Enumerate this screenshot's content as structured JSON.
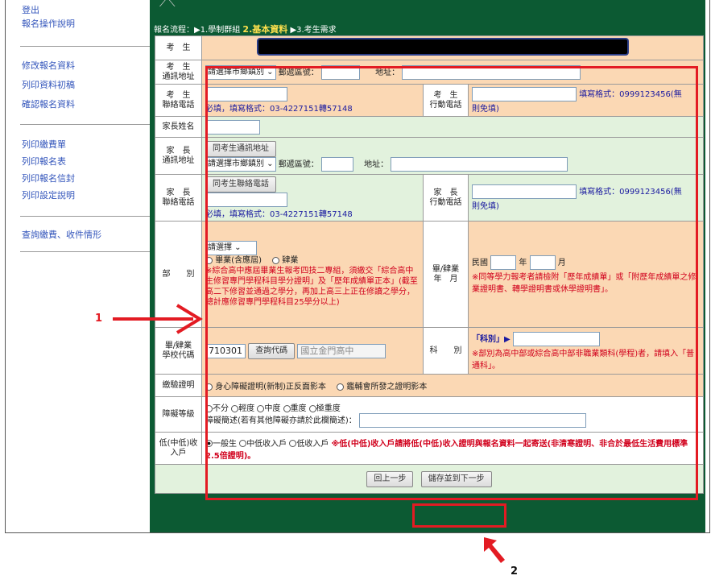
{
  "sidebar": {
    "items": [
      {
        "label": "登出"
      },
      {
        "label": "報名操作說明"
      },
      {
        "label": "修改報名資料"
      },
      {
        "label": "列印資料初稿"
      },
      {
        "label": "確認報名資料"
      },
      {
        "label": "列印繳費單"
      },
      {
        "label": "列印報名表"
      },
      {
        "label": "列印報名信封"
      },
      {
        "label": "列印設定說明"
      },
      {
        "label": "查詢繳費、收件情形"
      }
    ]
  },
  "flow": {
    "prefix": "報名流程：",
    "step1": "▶1.學制群組",
    "step2": "2.基本資料",
    "step3": "▶3.考生需求"
  },
  "form": {
    "student_label": "考　生",
    "addr_label": "考　生\n通訊地址",
    "county_select": "請選擇市鄉鎮別",
    "zip_label": "郵遞區號：",
    "addr_field_label": "地址：",
    "phone_label": "考　生\n聯絡電話",
    "phone_hint": "必填，填寫格式：03-4227151轉57148",
    "mobile_label": "考　生\n行動電話",
    "mobile_hint_a": "填寫格式：0999123456(無",
    "mobile_hint_b": "則免填)",
    "parent_name_label": "家長姓名",
    "parent_addr_label": "家　長\n通訊地址",
    "same_addr_btn": "同考生通訊地址",
    "parent_phone_label": "家　長\n聯絡電話",
    "same_phone_btn": "同考生聯絡電話",
    "parent_phone_hint": "必填，填寫格式：03-4227151轉57148",
    "parent_mobile_label": "家　長\n行動電話",
    "dept_label": "部　　別",
    "dept_select": "請選擇",
    "grad_option": "畢業(含應屆)",
    "drop_option": "肄業",
    "dept_note": "※綜合高中應屆畢業生報考四技二專組，須繳交「綜合高中生修習專門學程科目學分證明」及「歷年成績單正本」(截至高二下修習並通過之學分，再加上高三上正在修讀之學分，總計應修習專門學程科目25學分以上)",
    "grad_ym_label": "畢/肄業\n年　月",
    "roc_label": "民國",
    "year_label": "年",
    "month_label": "月",
    "grad_note": "※同等學力報考者請檢附「歷年成績單」或「附歷年成績單之修業證明書、轉學證明書或休學證明書」。",
    "school_code_label": "畢/肄業\n學校代碼",
    "school_code": "710301",
    "query_btn": "查詢代碼",
    "school_name": "國立金門高中",
    "subject_label": "科　　別",
    "subject_tag": "「科別」▶",
    "subject_note": "※部別為高中部或綜合高中部非職業類科(學程)者，請填入「普通科」。",
    "verify_label": "繳驗證明",
    "verify_opt1": "身心障礙證明(新制)正反面影本",
    "verify_opt2": "鑑輔會所發之證明影本",
    "disability_label": "障礙等級",
    "dis_opts": [
      "不分",
      "輕度",
      "中度",
      "重度",
      "極重度"
    ],
    "dis_desc_label": "障礙簡述(若有其他障礙亦請於此欄簡述)：",
    "income_label": "低(中低)收\n入戶",
    "income_opts": [
      "一般生",
      "中低收入戶",
      "低收入戶"
    ],
    "income_note": "※低(中低)收入戶請將低(中低)收入證明與報名資料一起寄送(非清寒證明、非合於最低生活費用標準2.5倍證明)。",
    "prev_btn": "回上一步",
    "next_btn": "儲存並到下一步"
  },
  "annotations": {
    "label1": "1",
    "label2": "2"
  },
  "colors": {
    "header_green": "#0c5a33",
    "value_orange": "#fbd8b4",
    "value_green": "#e2f2dd",
    "highlight_red": "#e31b23"
  }
}
